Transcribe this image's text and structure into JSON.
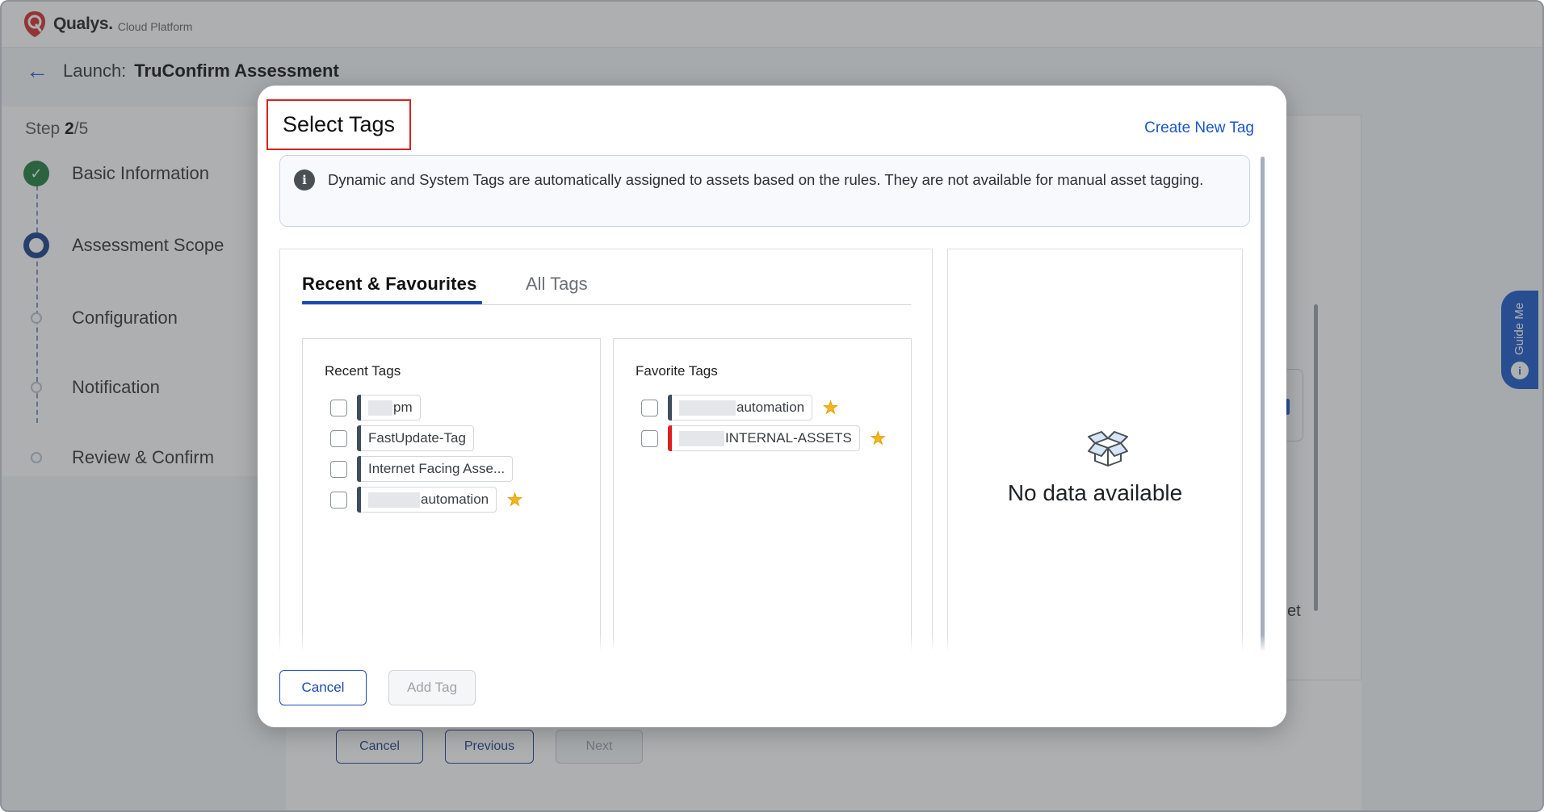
{
  "app": {
    "brand_name": "Qualys.",
    "brand_sub": "Cloud Platform",
    "launch_label": "Launch:",
    "launch_name": "TruConfirm Assessment"
  },
  "stepper": {
    "step_prefix": "Step",
    "step_current": "2",
    "step_total": "/5",
    "steps": [
      {
        "label": "Basic Information",
        "state": "done"
      },
      {
        "label": "Assessment Scope",
        "state": "active"
      },
      {
        "label": "Configuration",
        "state": "todo"
      },
      {
        "label": "Notification",
        "state": "todo"
      },
      {
        "label": "Review & Confirm",
        "state": "todo"
      }
    ]
  },
  "background": {
    "cancel_label": "Cancel",
    "previous_label": "Previous",
    "next_label": "Next",
    "partial_text": "et",
    "guide_me_label": "Guide Me"
  },
  "modal": {
    "title": "Select Tags",
    "create_new_tag": "Create New Tag",
    "info_text": "Dynamic and System Tags are automatically assigned to assets based on the rules. They are not available for manual asset tagging.",
    "tabs": [
      {
        "label": "Recent & Favourites",
        "active": true
      },
      {
        "label": "All Tags",
        "active": false
      }
    ],
    "recent": {
      "title": "Recent Tags",
      "tags": [
        {
          "text": "pm",
          "redacted_prefix": true,
          "favorite": false,
          "bar_color": "#3f4e5e"
        },
        {
          "text": "FastUpdate-Tag",
          "redacted_prefix": false,
          "favorite": false,
          "bar_color": "#3f4e5e"
        },
        {
          "text": "Internet Facing Asse...",
          "redacted_prefix": false,
          "favorite": false,
          "bar_color": "#3f4e5e"
        },
        {
          "text": "automation",
          "redacted_prefix": true,
          "favorite": true,
          "bar_color": "#3f4e5e"
        }
      ]
    },
    "favorites": {
      "title": "Favorite Tags",
      "tags": [
        {
          "text": "automation",
          "redacted_prefix": true,
          "favorite": true,
          "bar_color": "#3f4e5e"
        },
        {
          "text": "INTERNAL-ASSETS",
          "redacted_prefix": true,
          "favorite": true,
          "bar_color": "#e02020"
        }
      ]
    },
    "empty_text": "No data available",
    "cancel_label": "Cancel",
    "add_tag_label": "Add Tag"
  },
  "colors": {
    "accent": "#1a49b8",
    "link": "#1a56c8",
    "success": "#1e7d3a",
    "star": "#f3b61f",
    "highlight_box": "#d92121"
  }
}
